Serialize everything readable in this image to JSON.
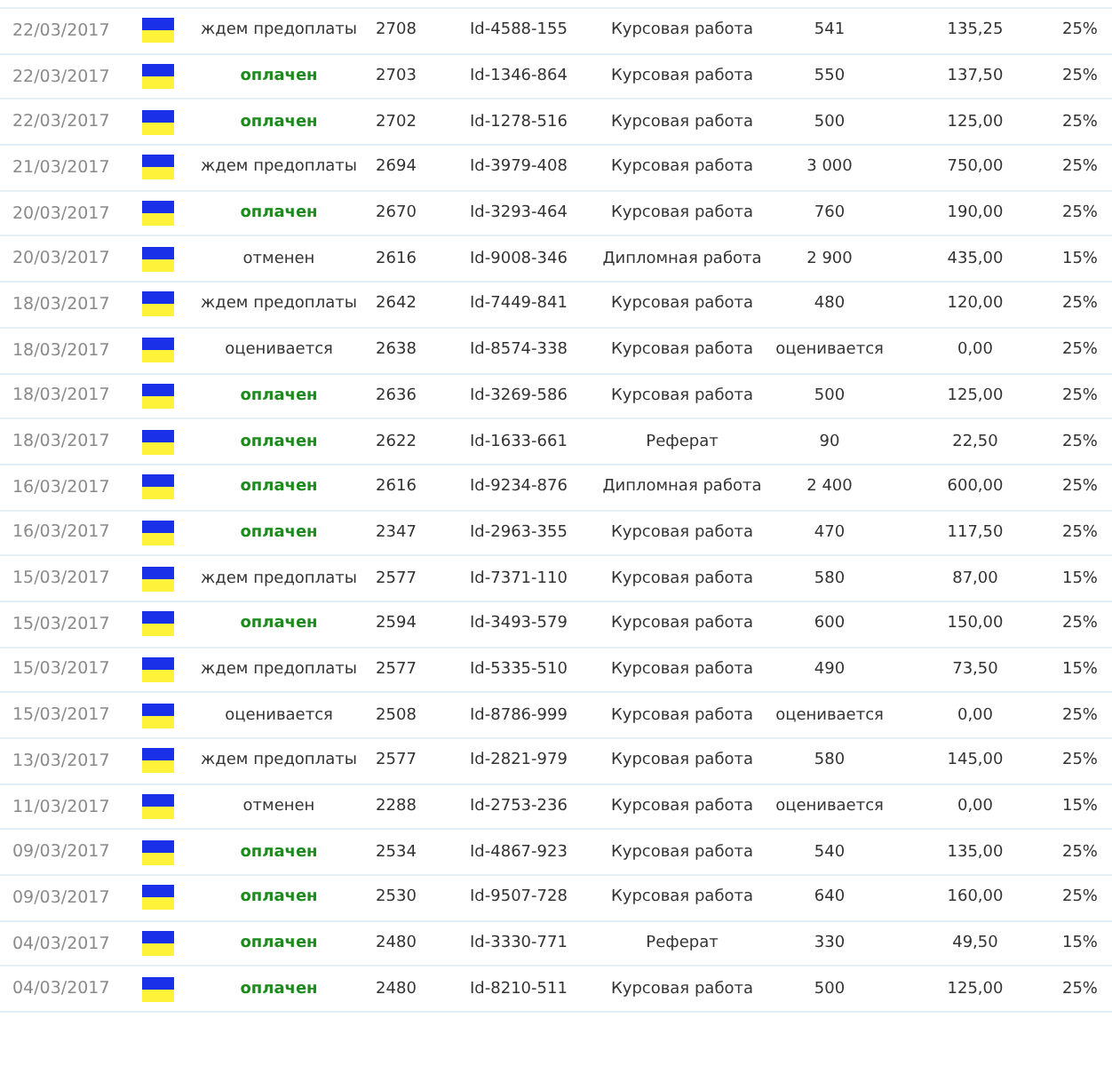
{
  "rows": [
    {
      "date": "22/03/2017",
      "status": "ждем предоплаты",
      "paid": false,
      "number": "2708",
      "id": "Id-4588-155",
      "type": "Курсовая работа",
      "pages": "541",
      "sum": "135,25",
      "percent": "25%"
    },
    {
      "date": "22/03/2017",
      "status": "оплачен",
      "paid": true,
      "number": "2703",
      "id": "Id-1346-864",
      "type": "Курсовая работа",
      "pages": "550",
      "sum": "137,50",
      "percent": "25%"
    },
    {
      "date": "22/03/2017",
      "status": "оплачен",
      "paid": true,
      "number": "2702",
      "id": "Id-1278-516",
      "type": "Курсовая работа",
      "pages": "500",
      "sum": "125,00",
      "percent": "25%"
    },
    {
      "date": "21/03/2017",
      "status": "ждем предоплаты",
      "paid": false,
      "number": "2694",
      "id": "Id-3979-408",
      "type": "Курсовая работа",
      "pages": "3 000",
      "sum": "750,00",
      "percent": "25%"
    },
    {
      "date": "20/03/2017",
      "status": "оплачен",
      "paid": true,
      "number": "2670",
      "id": "Id-3293-464",
      "type": "Курсовая работа",
      "pages": "760",
      "sum": "190,00",
      "percent": "25%"
    },
    {
      "date": "20/03/2017",
      "status": "отменен",
      "paid": false,
      "number": "2616",
      "id": "Id-9008-346",
      "type": "Дипломная работа",
      "pages": "2 900",
      "sum": "435,00",
      "percent": "15%"
    },
    {
      "date": "18/03/2017",
      "status": "ждем предоплаты",
      "paid": false,
      "number": "2642",
      "id": "Id-7449-841",
      "type": "Курсовая работа",
      "pages": "480",
      "sum": "120,00",
      "percent": "25%"
    },
    {
      "date": "18/03/2017",
      "status": "оценивается",
      "paid": false,
      "number": "2638",
      "id": "Id-8574-338",
      "type": "Курсовая работа",
      "pages": "оценивается",
      "sum": "0,00",
      "percent": "25%"
    },
    {
      "date": "18/03/2017",
      "status": "оплачен",
      "paid": true,
      "number": "2636",
      "id": "Id-3269-586",
      "type": "Курсовая работа",
      "pages": "500",
      "sum": "125,00",
      "percent": "25%"
    },
    {
      "date": "18/03/2017",
      "status": "оплачен",
      "paid": true,
      "number": "2622",
      "id": "Id-1633-661",
      "type": "Реферат",
      "pages": "90",
      "sum": "22,50",
      "percent": "25%"
    },
    {
      "date": "16/03/2017",
      "status": "оплачен",
      "paid": true,
      "number": "2616",
      "id": "Id-9234-876",
      "type": "Дипломная работа",
      "pages": "2 400",
      "sum": "600,00",
      "percent": "25%"
    },
    {
      "date": "16/03/2017",
      "status": "оплачен",
      "paid": true,
      "number": "2347",
      "id": "Id-2963-355",
      "type": "Курсовая работа",
      "pages": "470",
      "sum": "117,50",
      "percent": "25%"
    },
    {
      "date": "15/03/2017",
      "status": "ждем предоплаты",
      "paid": false,
      "number": "2577",
      "id": "Id-7371-110",
      "type": "Курсовая работа",
      "pages": "580",
      "sum": "87,00",
      "percent": "15%"
    },
    {
      "date": "15/03/2017",
      "status": "оплачен",
      "paid": true,
      "number": "2594",
      "id": "Id-3493-579",
      "type": "Курсовая работа",
      "pages": "600",
      "sum": "150,00",
      "percent": "25%"
    },
    {
      "date": "15/03/2017",
      "status": "ждем предоплаты",
      "paid": false,
      "number": "2577",
      "id": "Id-5335-510",
      "type": "Курсовая работа",
      "pages": "490",
      "sum": "73,50",
      "percent": "15%"
    },
    {
      "date": "15/03/2017",
      "status": "оценивается",
      "paid": false,
      "number": "2508",
      "id": "Id-8786-999",
      "type": "Курсовая работа",
      "pages": "оценивается",
      "sum": "0,00",
      "percent": "25%"
    },
    {
      "date": "13/03/2017",
      "status": "ждем предоплаты",
      "paid": false,
      "number": "2577",
      "id": "Id-2821-979",
      "type": "Курсовая работа",
      "pages": "580",
      "sum": "145,00",
      "percent": "25%"
    },
    {
      "date": "11/03/2017",
      "status": "отменен",
      "paid": false,
      "number": "2288",
      "id": "Id-2753-236",
      "type": "Курсовая работа",
      "pages": "оценивается",
      "sum": "0,00",
      "percent": "15%"
    },
    {
      "date": "09/03/2017",
      "status": "оплачен",
      "paid": true,
      "number": "2534",
      "id": "Id-4867-923",
      "type": "Курсовая работа",
      "pages": "540",
      "sum": "135,00",
      "percent": "25%"
    },
    {
      "date": "09/03/2017",
      "status": "оплачен",
      "paid": true,
      "number": "2530",
      "id": "Id-9507-728",
      "type": "Курсовая работа",
      "pages": "640",
      "sum": "160,00",
      "percent": "25%"
    },
    {
      "date": "04/03/2017",
      "status": "оплачен",
      "paid": true,
      "number": "2480",
      "id": "Id-3330-771",
      "type": "Реферат",
      "pages": "330",
      "sum": "49,50",
      "percent": "15%"
    },
    {
      "date": "04/03/2017",
      "status": "оплачен",
      "paid": true,
      "number": "2480",
      "id": "Id-8210-511",
      "type": "Курсовая работа",
      "pages": "500",
      "sum": "125,00",
      "percent": "25%"
    }
  ]
}
